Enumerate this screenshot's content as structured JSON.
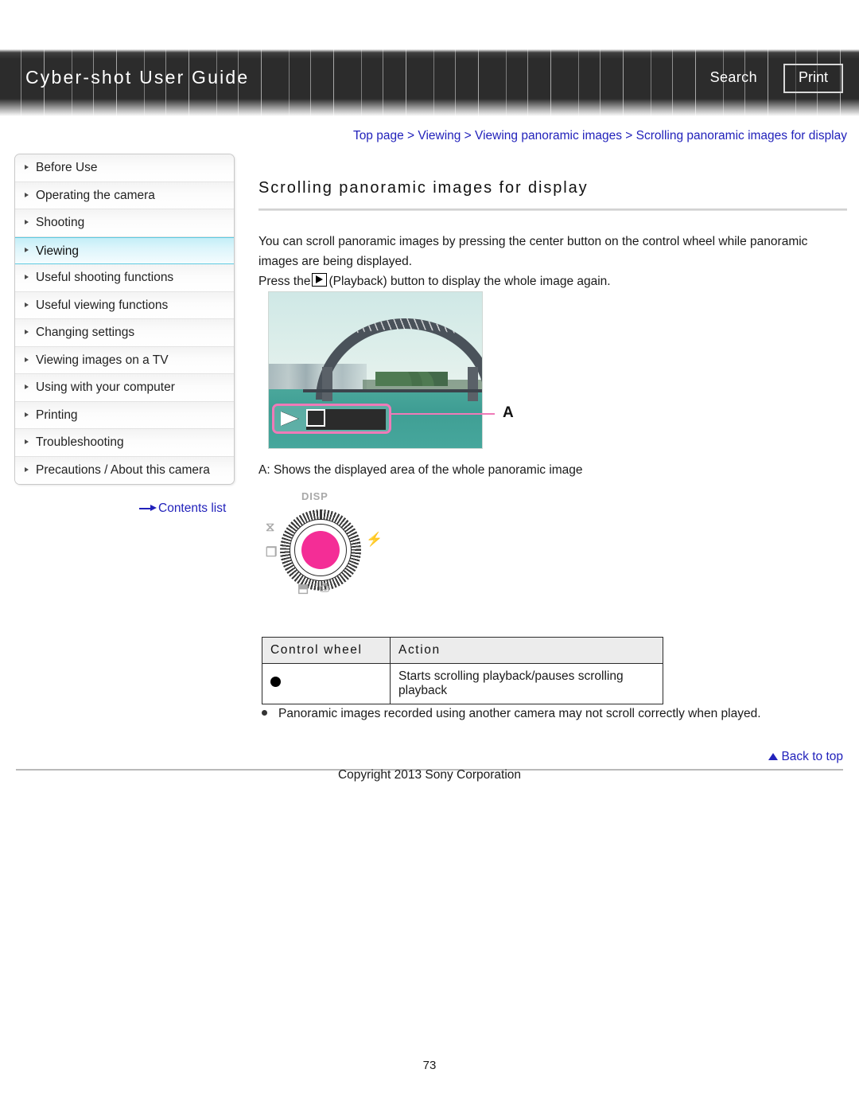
{
  "header": {
    "title": "Cyber-shot User Guide",
    "search_label": "Search",
    "print_label": "Print"
  },
  "breadcrumb": {
    "text": "Top page > Viewing > Viewing panoramic images > Scrolling panoramic images for display",
    "link_color": "#2222bb"
  },
  "sidebar": {
    "items": [
      {
        "label": "Before Use",
        "active": false
      },
      {
        "label": "Operating the camera",
        "active": false
      },
      {
        "label": "Shooting",
        "active": false
      },
      {
        "label": "Viewing",
        "active": true
      },
      {
        "label": "Useful shooting functions",
        "active": false
      },
      {
        "label": "Useful viewing functions",
        "active": false
      },
      {
        "label": "Changing settings",
        "active": false
      },
      {
        "label": "Viewing images on a TV",
        "active": false
      },
      {
        "label": "Using with your computer",
        "active": false
      },
      {
        "label": "Printing",
        "active": false
      },
      {
        "label": "Troubleshooting",
        "active": false
      },
      {
        "label": "Precautions / About this camera",
        "active": false
      }
    ],
    "contents_link": "Contents list",
    "active_highlight_color": "#5fcbe2"
  },
  "main": {
    "title": "Scrolling panoramic images for display",
    "paragraph1": "You can scroll panoramic images by pressing the center button on the control wheel while panoramic images are being displayed.",
    "paragraph2_before": "Press the",
    "paragraph2_after": "(Playback) button to display the whole image again.",
    "figure_caption": "A: Shows the displayed area of the whole panoramic image",
    "figure_label": "A",
    "overlay_accent_color": "#ef7ab8"
  },
  "control_wheel": {
    "label_disp": "DISP",
    "label_timer": "⧖",
    "label_burst": "❐",
    "label_flash": "⚡",
    "label_ev": "⬒",
    "label_camera": "⎙",
    "center_color": "#f42d96"
  },
  "table": {
    "headers": [
      "Control wheel",
      "Action"
    ],
    "rows": [
      {
        "control": "●",
        "action": "Starts scrolling playback/pauses scrolling playback"
      }
    ]
  },
  "notes": [
    "Panoramic images recorded using another camera may not scroll correctly when played."
  ],
  "footer": {
    "back_to_top": "Back to top",
    "copyright": "Copyright 2013 Sony Corporation",
    "page_number": "73"
  }
}
